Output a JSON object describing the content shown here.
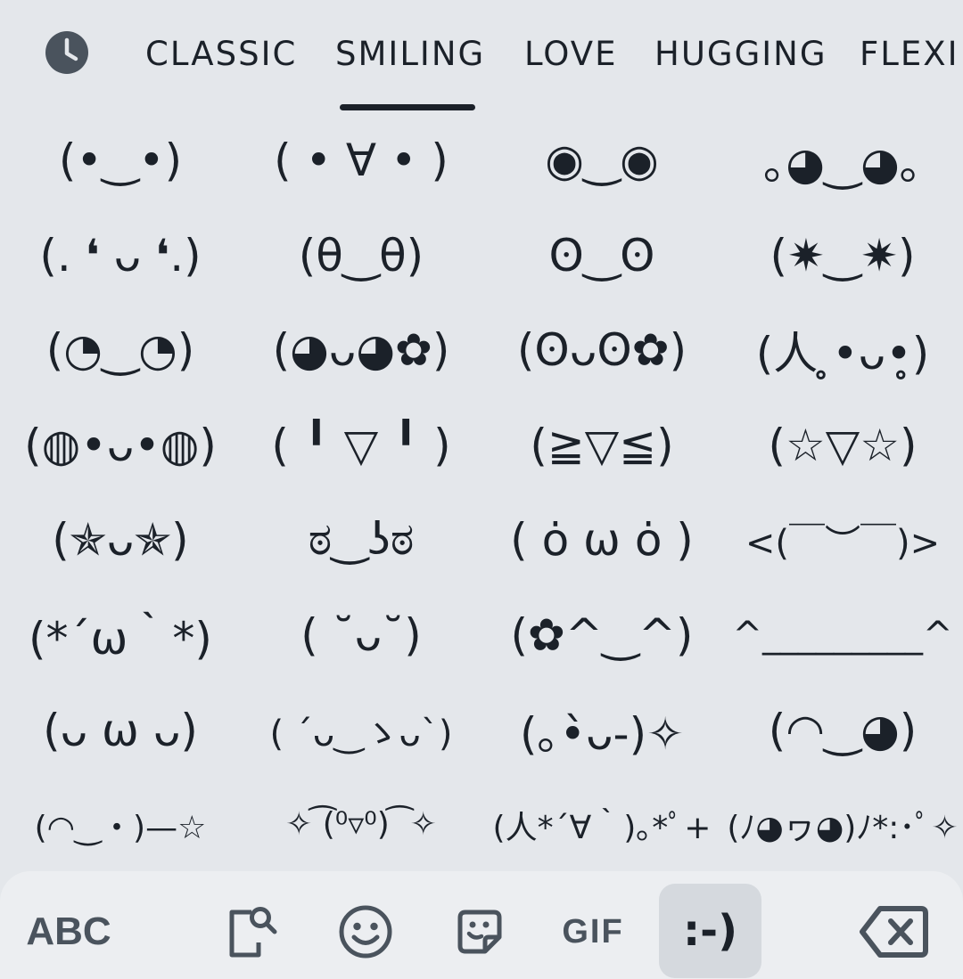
{
  "tabs": [
    "CLASSIC",
    "SMILING",
    "LOVE",
    "HUGGING",
    "FLEXI"
  ],
  "selected_tab": "SMILING",
  "icons": {
    "recent": "clock-icon",
    "search": "sticker-search-icon",
    "emoji": "smiley-icon",
    "sticker": "sticker-icon",
    "backspace": "backspace-icon"
  },
  "emoticons": [
    [
      "(•‿•)",
      "( • ∀ • )",
      "◉‿◉",
      "｡◕‿◕｡"
    ],
    [
      "(. ❛ ᴗ ❛.)",
      "(θ‿θ)",
      "ʘ‿ʘ",
      "(✷‿✷)"
    ],
    [
      "(◔‿◔)",
      "(◕ᴗ◕✿)",
      "(ʘᴗʘ✿)",
      "(人 ̥•ᴗ•̥)"
    ],
    [
      "(◍•ᴗ•◍)",
      "( ╹ ▽ ╹ )",
      "(≧▽≦)",
      "(☆▽☆)"
    ],
    [
      "(✯ᴗ✯)",
      "ಠ‿ʖಠ",
      "( ȯ ω ȯ )",
      "<(￣︶￣)>"
    ],
    [
      "(*´ω｀*)",
      "( ˘ᴗ˘)",
      "(✿^‿^)",
      "^_________^"
    ],
    [
      "(ᴗ ω ᴗ)",
      "( ´ᴗ‿ゝᴗ`)",
      "(｡•̀ᴗ-)✧",
      "(◠‿◕)"
    ],
    [
      "(◠‿・)—☆",
      "✧ ͡(⁰▿⁰) ͡ ✧",
      "(人*´∀｀)｡*ﾟ+",
      "(ﾉ◕ヮ◕)ﾉ*:･ﾟ✧"
    ]
  ],
  "toolbar": {
    "abc_label": "ABC",
    "gif_label": "GIF",
    "emoticon_label": ":-)"
  },
  "colors": {
    "background": "#e4e7eb",
    "toolbar_bg": "#eceef1",
    "selected_bg": "#d5d9de",
    "text": "#1b2129",
    "icon": "#4a535d"
  }
}
